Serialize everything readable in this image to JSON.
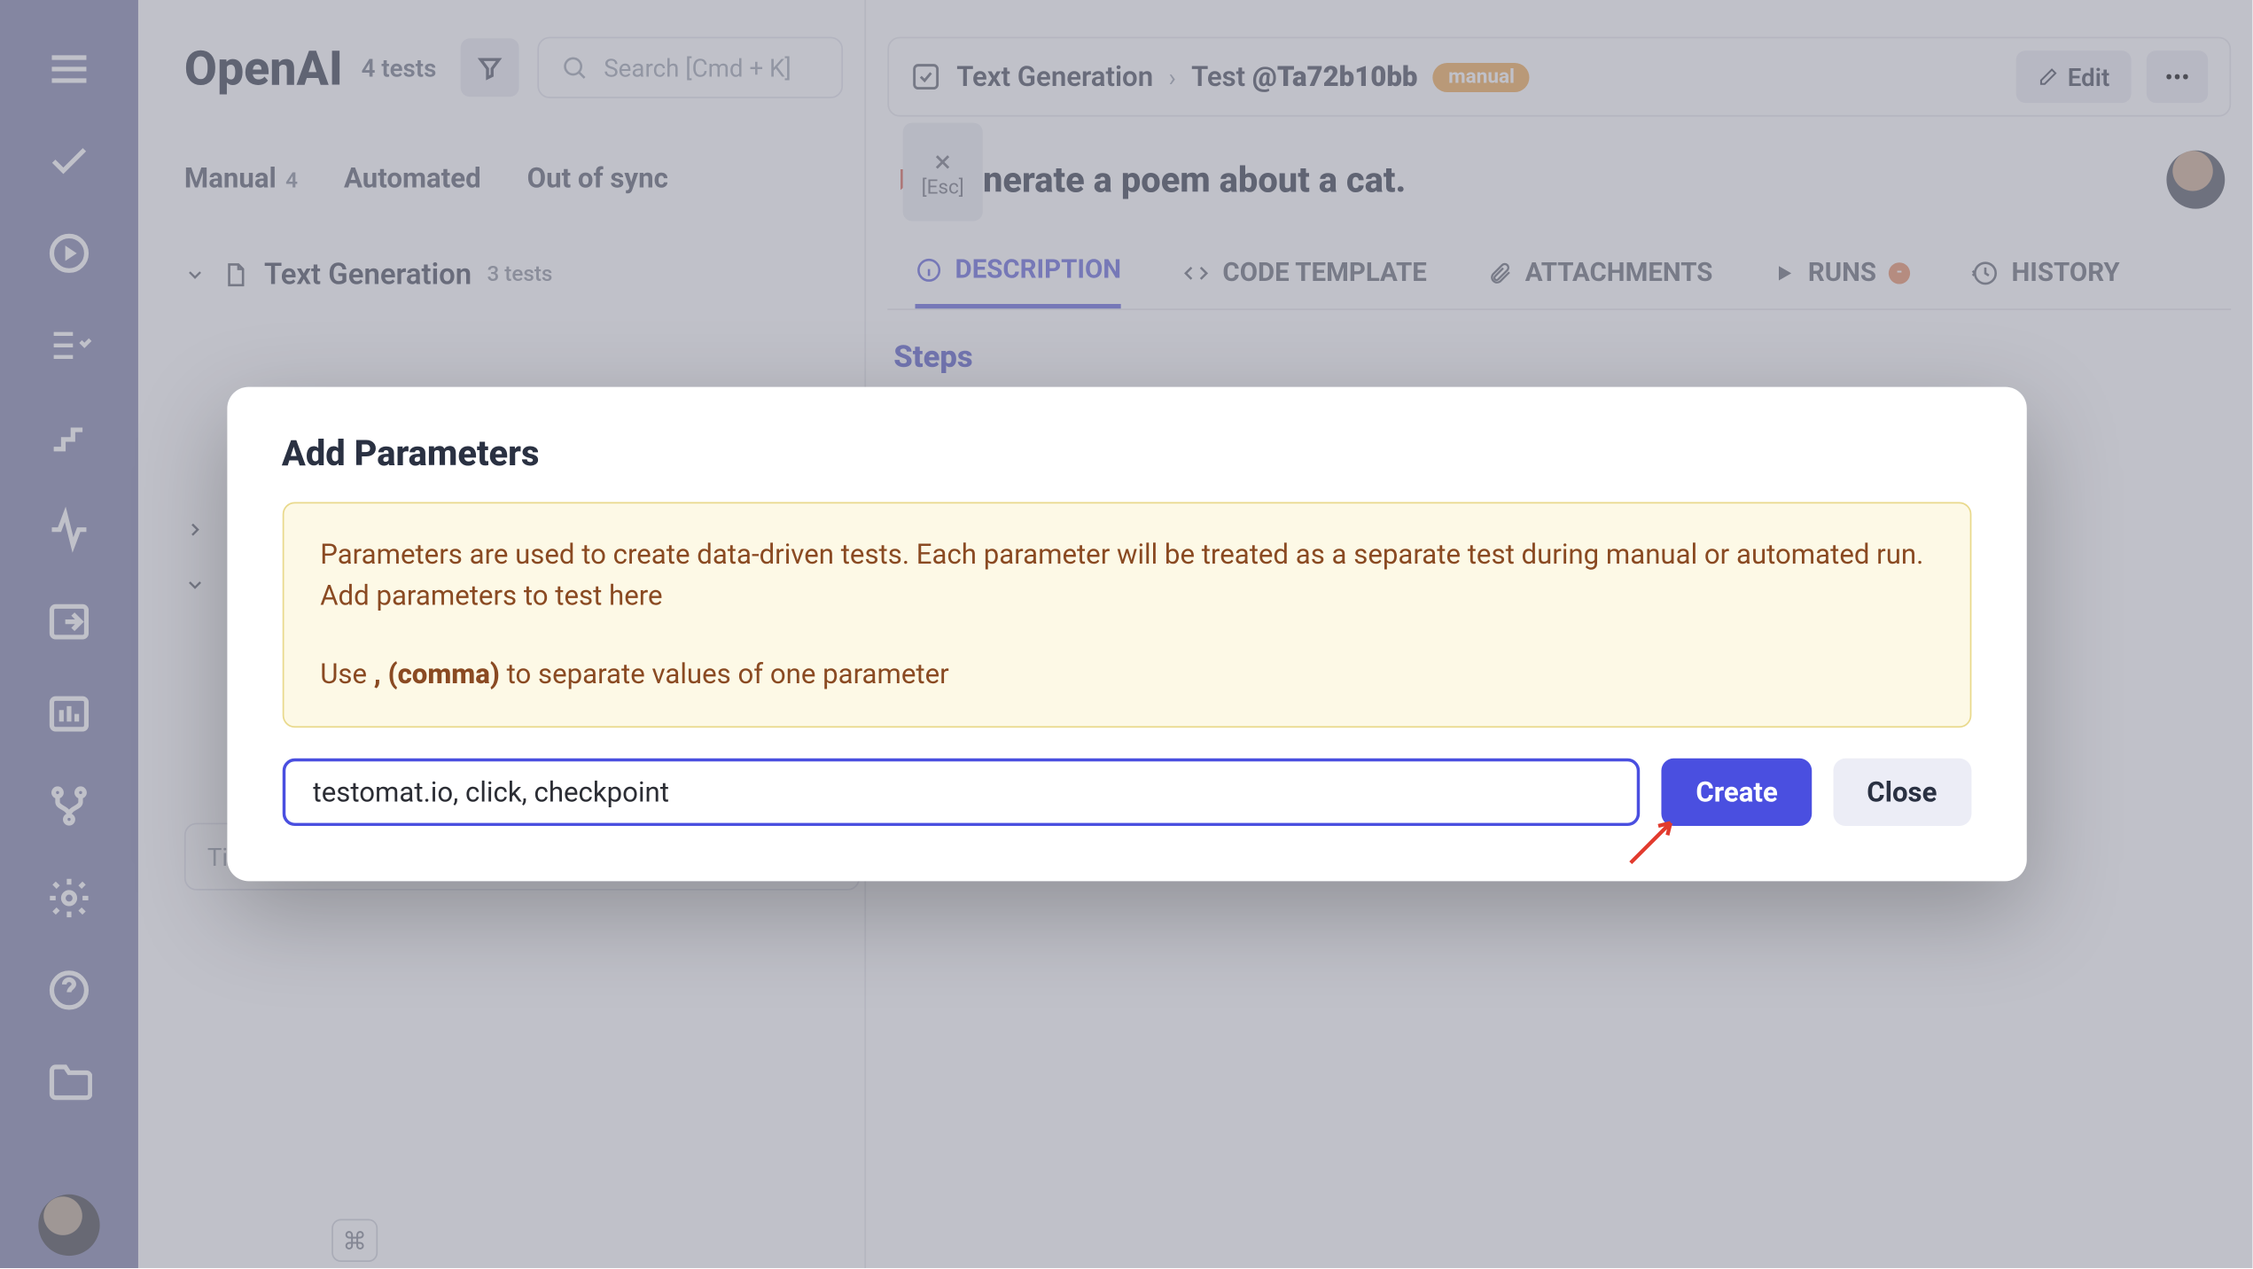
{
  "project": {
    "title": "OpenAI",
    "count": "4 tests"
  },
  "search": {
    "placeholder": "Search [Cmd + K]"
  },
  "tabs": {
    "manual": "Manual",
    "manual_count": "4",
    "automated": "Automated",
    "outofsync": "Out of sync"
  },
  "esc": {
    "x": "×",
    "label": "[Esc]"
  },
  "suite": {
    "name": "Text Generation",
    "count": "3 tests"
  },
  "new_suite_placeholder": "Title of new suite",
  "cmd_key": "⌘",
  "crumb": {
    "suite": "Text Generation",
    "sep": "›",
    "test_prefix": "Test ",
    "test_id": "@Ta72b10bb",
    "badge": "manual"
  },
  "actions": {
    "edit": "Edit",
    "more": "•••"
  },
  "test": {
    "title": "Generate a poem about a cat."
  },
  "detail_tabs": {
    "description": "DESCRIPTION",
    "code": "CODE TEMPLATE",
    "attachments": "ATTACHMENTS",
    "runs": "RUNS",
    "history": "HISTORY"
  },
  "steps_label": "Steps",
  "modal": {
    "title": "Add Parameters",
    "info1": "Parameters are used to create data-driven tests. Each parameter will be treated as a separate test during manual or automated run. Add parameters to test here",
    "info2a": "Use ",
    "info2b": ", (comma)",
    "info2c": " to separate values of one parameter",
    "input_value": "testomat.io, click, checkpoint",
    "create": "Create",
    "close": "Close"
  }
}
